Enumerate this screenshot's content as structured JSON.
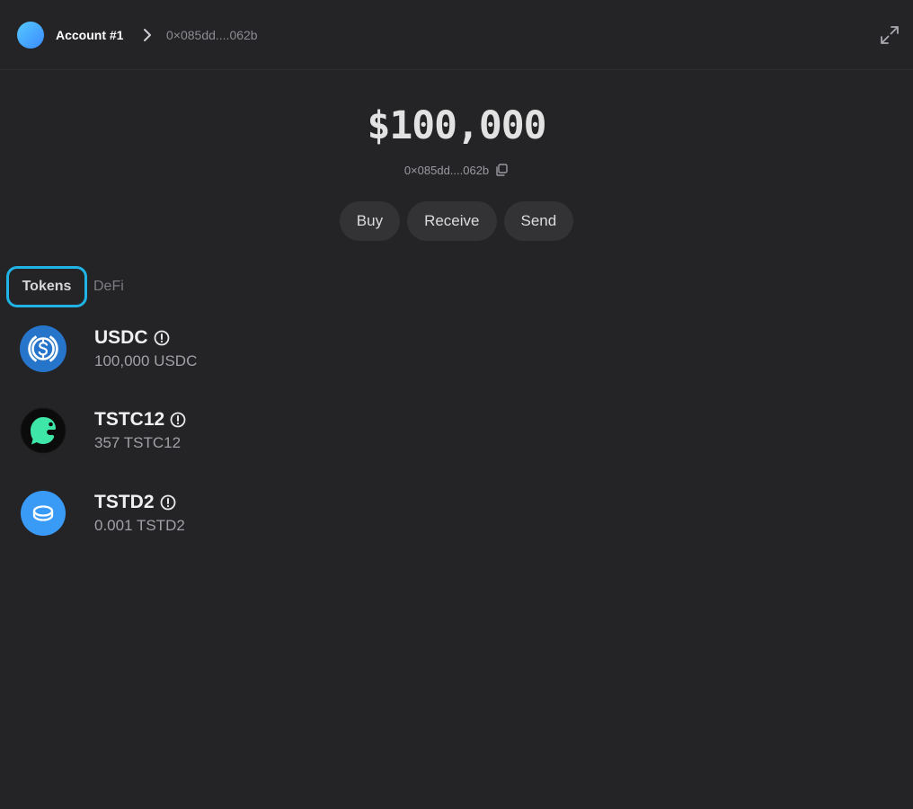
{
  "header": {
    "account_name": "Account #1",
    "address": "0×085dd....062b"
  },
  "wallet": {
    "balance": "$100,000",
    "address": "0×085dd....062b"
  },
  "actions": {
    "buy": "Buy",
    "receive": "Receive",
    "send": "Send"
  },
  "tabs": {
    "tokens": "Tokens",
    "defi": "DeFi"
  },
  "tokens": [
    {
      "name": "USDC",
      "amount": "100,000 USDC",
      "icon": "usdc-icon"
    },
    {
      "name": "TSTC12",
      "amount": "357 TSTC12",
      "icon": "tstc12-icon"
    },
    {
      "name": "TSTD2",
      "amount": "0.001 TSTD2",
      "icon": "tstd2-icon"
    }
  ],
  "colors": {
    "background": "#242426",
    "active_tab_border": "#1fb3e6",
    "usdc_blue": "#2775ca",
    "tstd2_blue": "#3a9bf7",
    "tstc12_green": "#3ee6a8"
  }
}
